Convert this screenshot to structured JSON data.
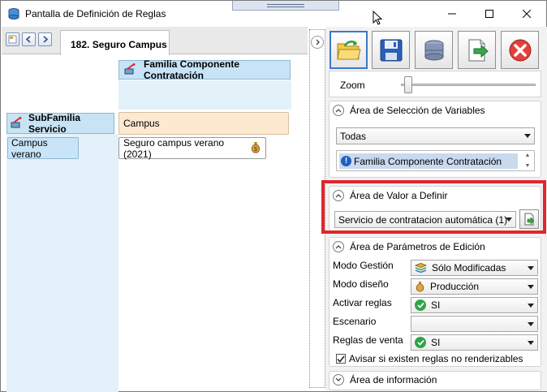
{
  "window": {
    "title": "Pantalla de Definición de Reglas"
  },
  "tab": {
    "label": "182. Seguro Campus"
  },
  "grid": {
    "column_header": "Familia Componente Contratación",
    "row_header": "SubFamilia Servicio",
    "column_value": "Campus",
    "row_value": "Campus verano",
    "cell_value": "Seguro campus verano (2021)"
  },
  "zoom": {
    "label": "Zoom"
  },
  "seleccion": {
    "title": "Área de Selección de Variables",
    "filter_value": "Todas",
    "items": [
      "Familia Componente Contratación"
    ]
  },
  "valor": {
    "title": "Área de Valor a Definir",
    "value": "Servicio de contratacion automática (1)"
  },
  "parametros": {
    "title": "Área de Parámetros de Edición",
    "rows": [
      {
        "label": "Modo Gestión",
        "value": "Sólo Modificadas"
      },
      {
        "label": "Modo diseño",
        "value": "Producción"
      },
      {
        "label": "Activar reglas",
        "value": "SI"
      },
      {
        "label": "Escenario",
        "value": ""
      },
      {
        "label": "Reglas de venta",
        "value": "SI"
      }
    ],
    "checkbox_label": "Avisar si existen reglas no renderizables",
    "checkbox_checked": true
  },
  "informacion": {
    "title": "Área de información"
  },
  "colors": {
    "header_blue": "#c7e3f5",
    "selected_cell": "#fde9d0",
    "highlight_red": "#e2262d"
  }
}
